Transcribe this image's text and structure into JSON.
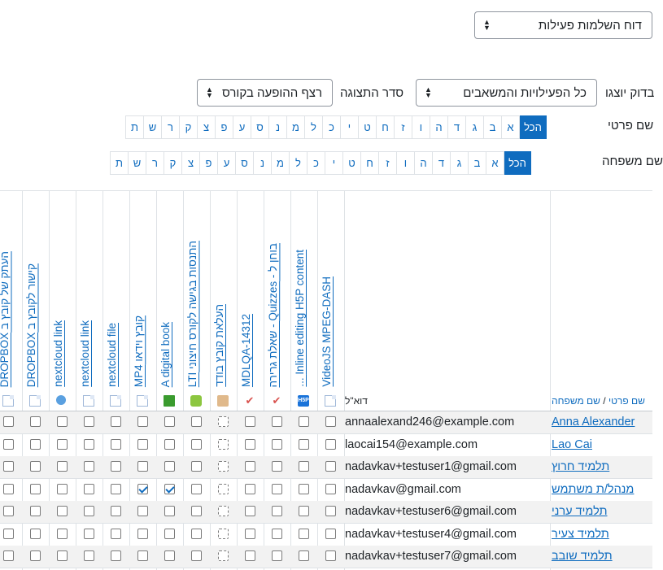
{
  "report_select": {
    "value": "דוח השלמות פעילות"
  },
  "filters": {
    "show_label": "בדוק יוצגו",
    "show_value": "כל הפעילויות והמשאבים",
    "order_label": "סדר התצוגה",
    "order_value": "רצף ההופעה בקורס"
  },
  "first_name_filter": {
    "label": "שם פרטי",
    "letters": [
      "הכל",
      "א",
      "ב",
      "ג",
      "ד",
      "ה",
      "ו",
      "ז",
      "ח",
      "ט",
      "י",
      "כ",
      "ל",
      "מ",
      "נ",
      "ס",
      "ע",
      "פ",
      "צ",
      "ק",
      "ר",
      "ש",
      "ת"
    ]
  },
  "last_name_filter": {
    "label": "שם משפחה",
    "letters": [
      "הכל",
      "א",
      "ב",
      "ג",
      "ד",
      "ה",
      "ו",
      "ז",
      "ח",
      "ט",
      "י",
      "כ",
      "ל",
      "מ",
      "נ",
      "ס",
      "ע",
      "פ",
      "צ",
      "ק",
      "ר",
      "ש",
      "ת"
    ]
  },
  "table": {
    "header_first": "שם פרטי",
    "header_sep": " / ",
    "header_last": "שם משפחה",
    "header_email": "דוא\"ל",
    "activities": [
      {
        "name": "VideoJS MPEG-DASH",
        "icon": "file-icon"
      },
      {
        "name": "Inline editing H5P content ...",
        "icon": "h5p-icon"
      },
      {
        "name": "בוחן ל - Quizzes - שאלת גרירה",
        "icon": "quiz-icon"
      },
      {
        "name": "MDLQA-14312",
        "icon": "quiz-icon"
      },
      {
        "name": "העלאת קובץ בודד",
        "icon": "assignment-icon"
      },
      {
        "name": "התנסות בגישה לקורס חיצוני LTI",
        "icon": "lti-icon"
      },
      {
        "name": "A digital book",
        "icon": "book-icon"
      },
      {
        "name": "קובץ וידאו MP4",
        "icon": "file-icon"
      },
      {
        "name": "nextcloud file",
        "icon": "file-icon"
      },
      {
        "name": "nextcloud link",
        "icon": "file-icon"
      },
      {
        "name": "nextcloud link",
        "icon": "url-icon"
      },
      {
        "name": "קישור לקובץ ב DROPBOX",
        "icon": "file-icon"
      },
      {
        "name": "העתק של קובץ ב DROPBOX",
        "icon": "file-icon"
      }
    ],
    "dashed_columns": [
      4
    ],
    "rows": [
      {
        "name": "Anna Alexander",
        "email": "annaalexand246@example.com",
        "checked": []
      },
      {
        "name": "Lao Cai",
        "email": "laocai154@example.com",
        "checked": []
      },
      {
        "name": "תלמיד חרוץ",
        "email": "nadavkav+testuser1@gmail.com",
        "checked": []
      },
      {
        "name": "מנהל/ת משתמש",
        "email": "nadavkav@gmail.com",
        "checked": [
          6,
          7
        ]
      },
      {
        "name": "תלמיד ערני",
        "email": "nadavkav+testuser6@gmail.com",
        "checked": []
      },
      {
        "name": "תלמיד צעיר",
        "email": "nadavkav+testuser4@gmail.com",
        "checked": []
      },
      {
        "name": "תלמיד שובב",
        "email": "nadavkav+testuser7@gmail.com",
        "checked": []
      }
    ]
  },
  "colors": {
    "accent": "#0f6cbf",
    "row_alt": "#f2f2f2",
    "border": "#dee2e6"
  }
}
